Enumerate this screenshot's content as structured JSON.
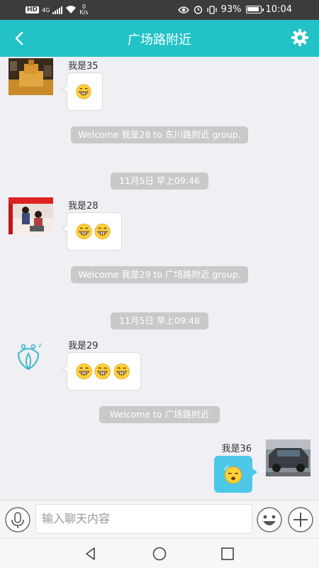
{
  "status_bar": {
    "network_label": "HD",
    "network_type": "4G",
    "net_speed_value": "0",
    "net_speed_unit": "K/s",
    "battery": "93%",
    "time": "10:04"
  },
  "header": {
    "title": "广场路附近",
    "back_icon": "chevron-left-icon",
    "settings_icon": "gear-icon"
  },
  "messages": [
    {
      "sender": "我是35",
      "emoji_count": 1,
      "emoji": "grin"
    },
    {
      "system": "Welcome 我是28 to 东川路附近 group."
    },
    {
      "time": "11月5日 早上09:46"
    },
    {
      "sender": "我是28",
      "emoji_count": 2,
      "emoji": "grin"
    },
    {
      "system": "Welcome 我是29 to 广场路附近 group."
    },
    {
      "time": "11月5日 早上09:48"
    },
    {
      "sender": "我是29",
      "emoji_count": 3,
      "emoji": "grin"
    },
    {
      "system": "Welcome to 广场路附近"
    },
    {
      "sender": "我是36",
      "emoji_count": 1,
      "emoji": "sleepy",
      "mine": true
    }
  ],
  "input": {
    "placeholder": "输入聊天内容"
  },
  "colors": {
    "accent": "#22c2c7",
    "mine_bubble": "#4dc8e8",
    "system_bubble": "#c9c9c9"
  }
}
